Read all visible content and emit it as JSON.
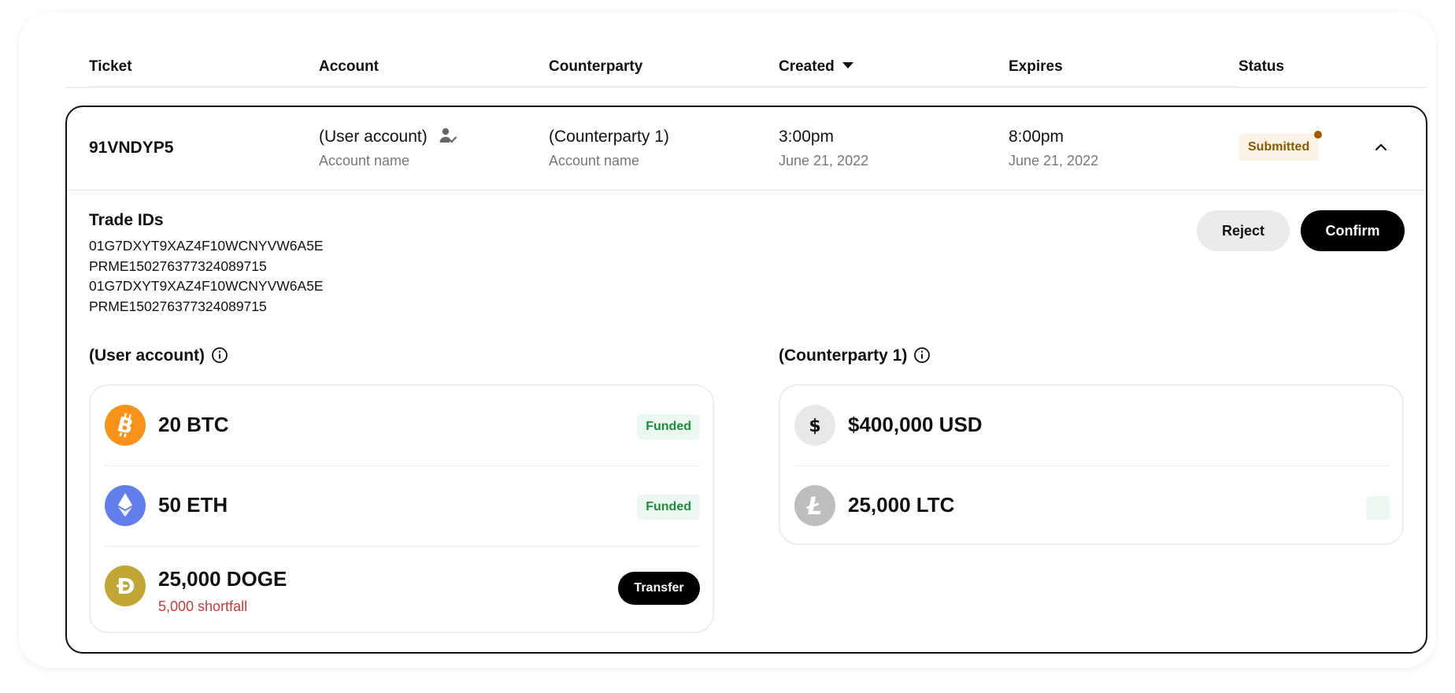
{
  "table": {
    "headers": {
      "ticket": "Ticket",
      "account": "Account",
      "counterparty": "Counterparty",
      "created": "Created",
      "expires": "Expires",
      "status": "Status"
    },
    "sort": {
      "column": "Created",
      "direction": "descending"
    }
  },
  "row": {
    "ticket": "91VNDYP5",
    "account": {
      "name": "(User account)",
      "sub": "Account name",
      "icon": "user-check-icon"
    },
    "counterparty": {
      "name": "(Counterparty 1)",
      "sub": "Account name"
    },
    "created": {
      "time": "3:00pm",
      "date": "June 21, 2022"
    },
    "expires": {
      "time": "8:00pm",
      "date": "June 21, 2022"
    },
    "status": {
      "label": "Submitted",
      "color": "#8a5a00",
      "dot_color": "#a35a00"
    },
    "expanded": true
  },
  "detail": {
    "trade_ids_title": "Trade IDs",
    "trade_ids": [
      "01G7DXYT9XAZ4F10WCNYVW6A5E",
      "PRME150276377324089715",
      "01G7DXYT9XAZ4F10WCNYVW6A5E",
      "PRME150276377324089715"
    ],
    "actions": {
      "reject": "Reject",
      "confirm": "Confirm"
    },
    "user_side": {
      "title": "(User account)",
      "assets": [
        {
          "amount": "20 BTC",
          "icon": "bitcoin-icon",
          "color": "#f7931a",
          "status": "Funded"
        },
        {
          "amount": "50 ETH",
          "icon": "ethereum-icon",
          "color": "#627eea",
          "status": "Funded"
        },
        {
          "amount": "25,000 DOGE",
          "icon": "dogecoin-icon",
          "color": "#c2a633",
          "shortfall": "5,000 shortfall",
          "action": "Transfer"
        }
      ]
    },
    "counterparty_side": {
      "title": "(Counterparty 1)",
      "assets": [
        {
          "amount": "$400,000 USD",
          "icon": "dollar-icon",
          "color": "#e8e8e8"
        },
        {
          "amount": "25,000 LTC",
          "icon": "litecoin-icon",
          "color": "#bebebe"
        }
      ]
    }
  }
}
